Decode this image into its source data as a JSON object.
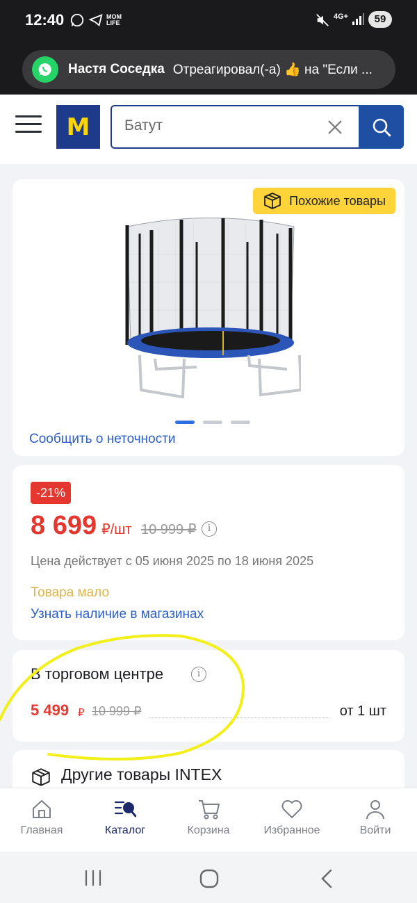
{
  "status_bar": {
    "time": "12:40",
    "network": "4G+",
    "battery": "59"
  },
  "notification": {
    "sender": "Настя Соседка",
    "text": "Отреагировал(-а) 👍 на \"Если ..."
  },
  "header": {
    "search_value": "Батут",
    "logo_letter": "M"
  },
  "product_image": {
    "similar_label": "Похожие товары",
    "report_label": "Сообщить о неточности",
    "active_slide_index": 0,
    "slide_count": 3
  },
  "price_block": {
    "discount": "-21%",
    "price": "8 699",
    "unit": "₽/шт",
    "old_price": "10 999 ₽",
    "validity": "Цена действует с 05 июня 2025 по 18 июня 2025",
    "stock": "Товара мало",
    "availability_link": "Узнать наличие в магазинах"
  },
  "mall_block": {
    "title": "В торговом центре",
    "price": "5 499",
    "currency": "₽",
    "old_price": "10 999 ₽",
    "qty": "от 1 шт"
  },
  "other_block": {
    "title": "Другие товары INTEX"
  },
  "bottom_nav": {
    "items": [
      {
        "label": "Главная",
        "icon": "home-icon"
      },
      {
        "label": "Каталог",
        "icon": "catalog-icon"
      },
      {
        "label": "Корзина",
        "icon": "cart-icon"
      },
      {
        "label": "Избранное",
        "icon": "heart-icon"
      },
      {
        "label": "Войти",
        "icon": "user-icon"
      }
    ],
    "active": "Каталог"
  },
  "colors": {
    "brand_blue": "#1e3a8a",
    "brand_yellow": "#ffd500",
    "price_red": "#e3372f",
    "link_blue": "#2b5fc7",
    "annotation_yellow": "#f2ef1a"
  }
}
